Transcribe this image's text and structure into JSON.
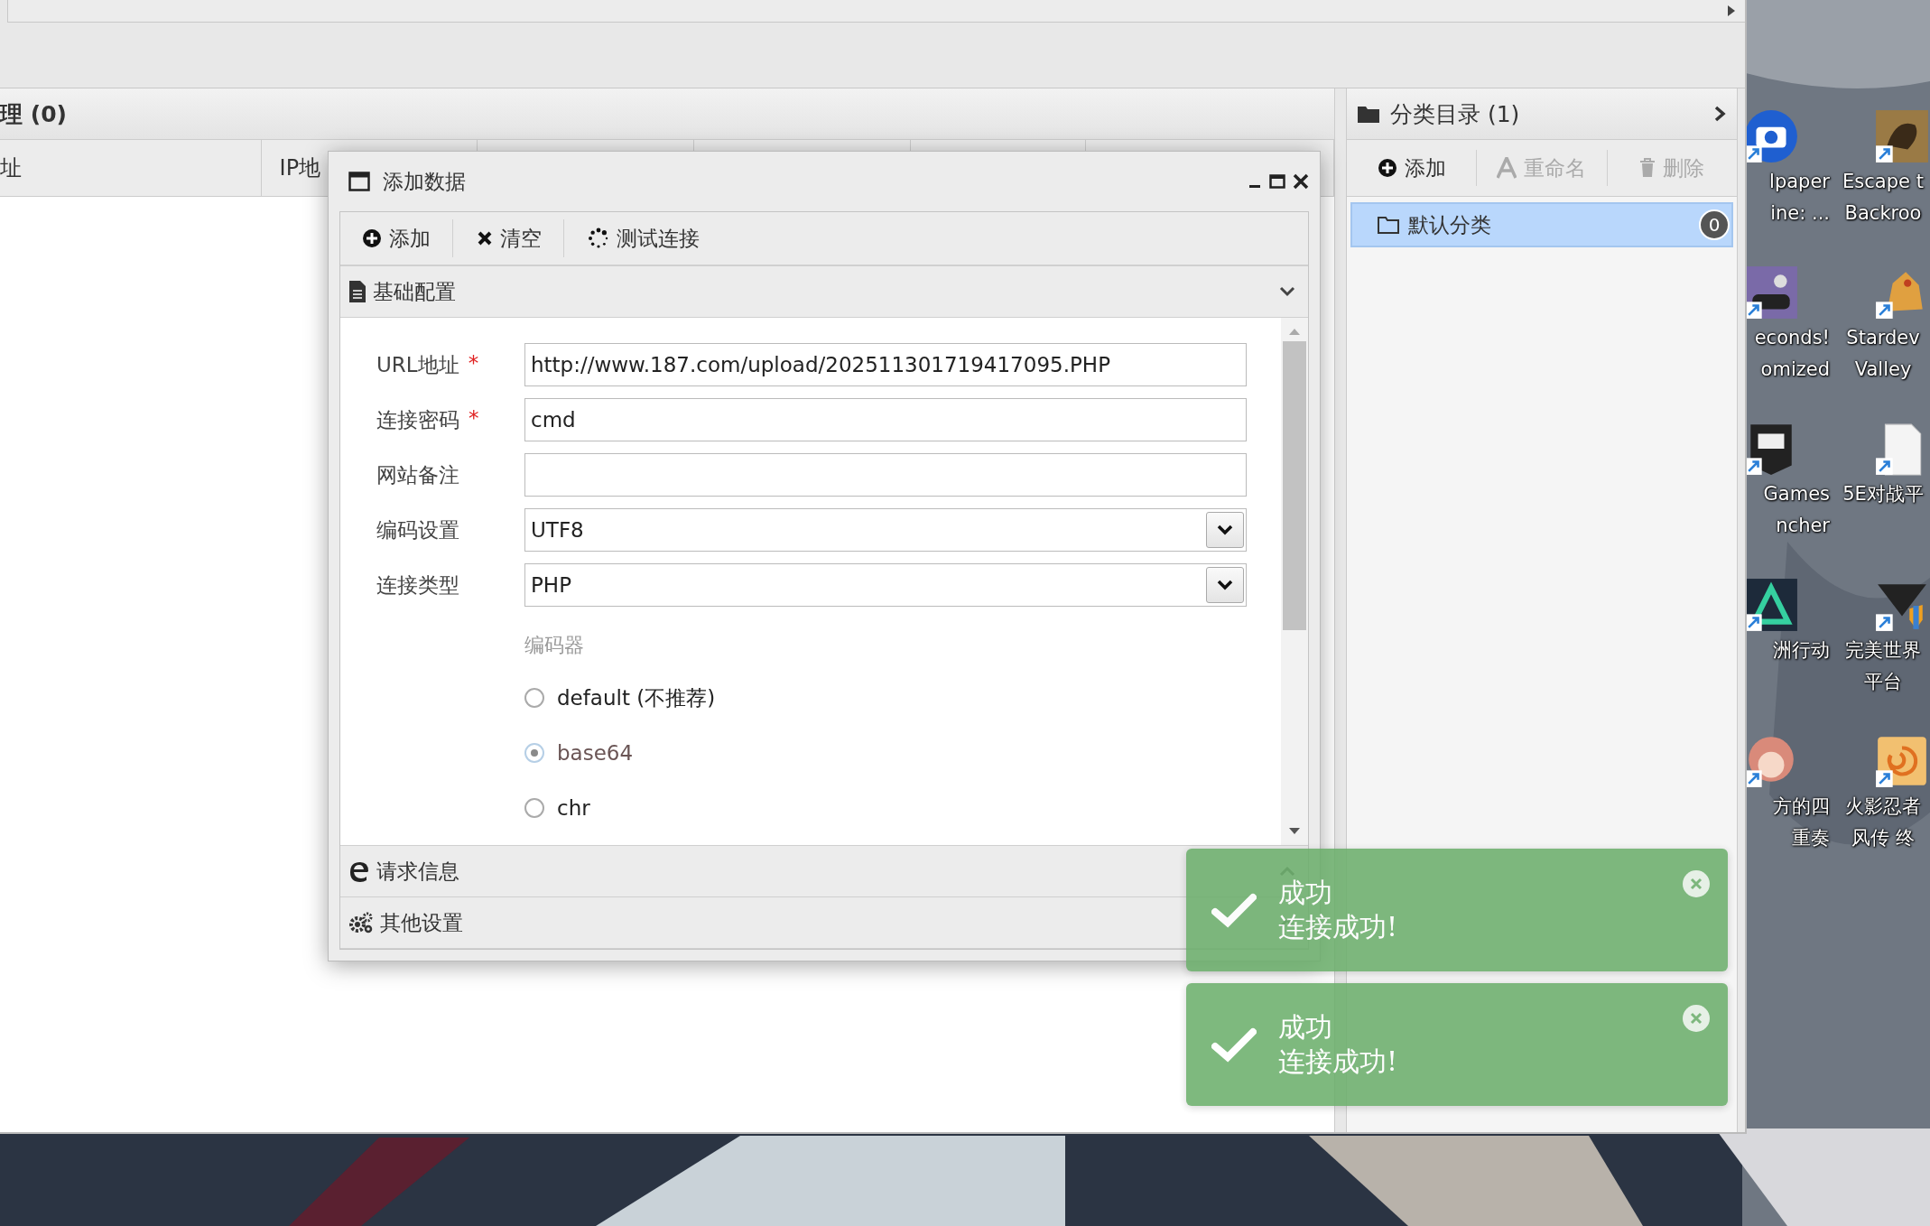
{
  "main_panel": {
    "title": "理 (0)",
    "columns": [
      "址",
      "IP地"
    ]
  },
  "category_panel": {
    "title": "分类目录 (1)",
    "toolbar": [
      {
        "label": "添加",
        "disabled": false
      },
      {
        "label": "重命名",
        "disabled": true
      },
      {
        "label": "删除",
        "disabled": true
      }
    ],
    "items": [
      {
        "label": "默认分类",
        "count": "0",
        "selected": true
      }
    ]
  },
  "dialog": {
    "title": "添加数据",
    "toolbar": [
      "添加",
      "清空",
      "测试连接"
    ],
    "sections": [
      {
        "title": "基础配置",
        "expanded": true
      },
      {
        "title": "请求信息",
        "expanded": false
      },
      {
        "title": "其他设置",
        "expanded": false
      }
    ],
    "form": [
      {
        "label": "URL地址",
        "marker": "*",
        "kind": "text",
        "value": "http://www.187.com/upload/202511301719417095.PHP"
      },
      {
        "label": "连接密码",
        "marker": "*",
        "kind": "text",
        "value": "cmd"
      },
      {
        "label": "网站备注",
        "kind": "text"
      },
      {
        "label": "编码设置",
        "kind": "select",
        "value": "UTF8"
      },
      {
        "label": "连接类型",
        "kind": "select",
        "value": "PHP"
      }
    ],
    "encoder": {
      "label": "编码器",
      "options": [
        {
          "label": "default (不推荐)",
          "selected": false
        },
        {
          "label": "base64",
          "selected": true
        },
        {
          "label": "chr",
          "selected": false
        }
      ]
    }
  },
  "toasts": [
    {
      "title": "成功",
      "message": "连接成功!"
    },
    {
      "title": "成功",
      "message": "连接成功!"
    }
  ],
  "desktop_icons": [
    {
      "lines": [
        "lpaper",
        "ine: ..."
      ]
    },
    {
      "lines": [
        "Escape t",
        "Backroo"
      ]
    },
    {
      "lines": [
        "econds!",
        "omized"
      ]
    },
    {
      "lines": [
        "Stardev",
        "Valley"
      ]
    },
    {
      "lines": [
        "Games",
        "ncher"
      ]
    },
    {
      "lines": [
        "5E对战平"
      ]
    },
    {
      "lines": [
        "洲行动"
      ]
    },
    {
      "lines": [
        "完美世界",
        "平台"
      ]
    },
    {
      "lines": [
        "方的四",
        "重奏"
      ]
    },
    {
      "lines": [
        "火影忍者",
        "风传 终"
      ]
    }
  ]
}
